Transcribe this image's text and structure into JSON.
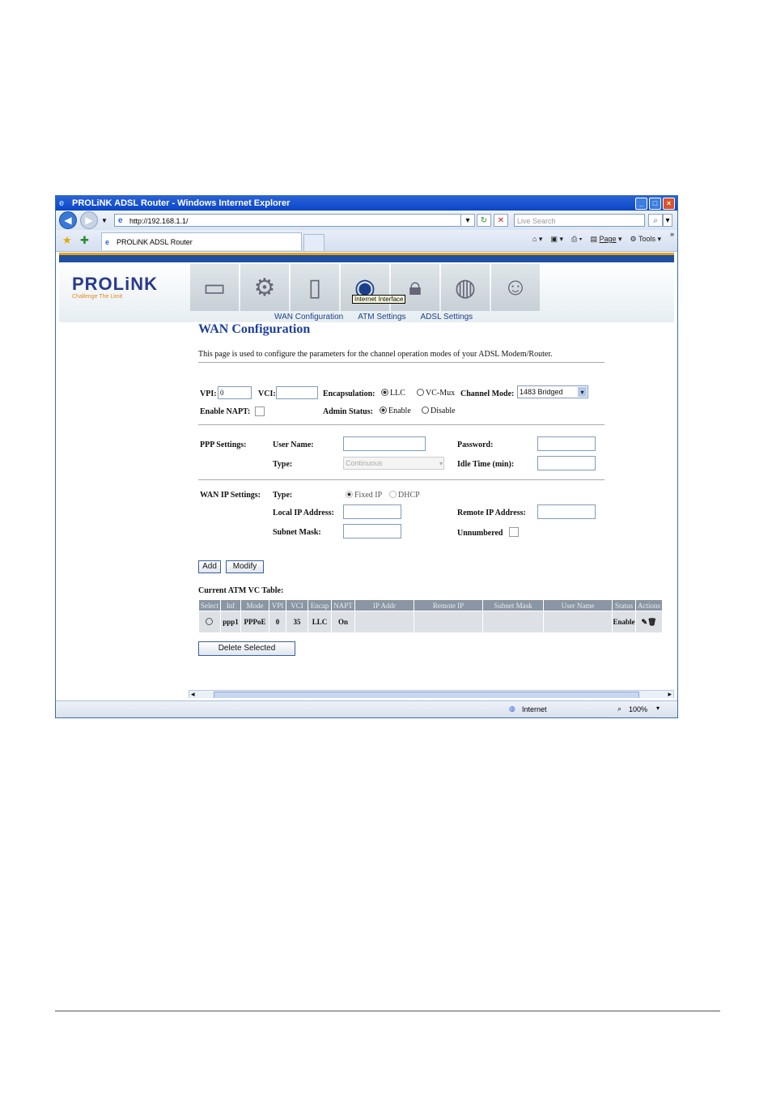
{
  "window": {
    "title": "PROLiNK ADSL Router - Windows Internet Explorer"
  },
  "browser": {
    "url": "http://192.168.1.1/",
    "search_placeholder": "Live Search",
    "tab_title": "PROLiNK ADSL Router",
    "tools": {
      "page": "Page",
      "tools": "Tools"
    }
  },
  "brand": {
    "logo": "PROLiNK",
    "tagline": "Challenge The Limit"
  },
  "tooltip": "Internet Interface",
  "subnav": {
    "wan": "WAN Configuration",
    "atm": "ATM Settings",
    "adsl": "ADSL Settings"
  },
  "page": {
    "title": "WAN Configuration",
    "description": "This page is used to configure the parameters for the channel operation modes of your ADSL Modem/Router."
  },
  "form": {
    "vpi_label": "VPI:",
    "vpi_value": "0",
    "vci_label": "VCI:",
    "vci_value": "",
    "encap_label": "Encapsulation:",
    "llc": "LLC",
    "vcmux": "VC-Mux",
    "channel_mode_label": "Channel Mode:",
    "channel_mode_value": "1483 Bridged",
    "napt_label": "Enable NAPT:",
    "admin_label": "Admin Status:",
    "enable": "Enable",
    "disable": "Disable",
    "ppp_label": "PPP Settings:",
    "user_label": "User Name:",
    "password_label": "Password:",
    "type_label": "Type:",
    "type_value": "Continuous",
    "idle_label": "Idle Time (min):",
    "wanip_label": "WAN IP Settings:",
    "wantype_label": "Type:",
    "fixed_ip": "Fixed IP",
    "dhcp": "DHCP",
    "local_ip_label": "Local IP Address:",
    "remote_ip_label": "Remote IP Address:",
    "subnet_label": "Subnet Mask:",
    "unnumbered_label": "Unnumbered",
    "add": "Add",
    "modify": "Modify"
  },
  "table": {
    "caption": "Current ATM VC Table:",
    "headers": [
      "Select",
      "Inf",
      "Mode",
      "VPI",
      "VCI",
      "Encap",
      "NAPT",
      "IP Addr",
      "Remote IP",
      "Subnet Mask",
      "User Name",
      "Status",
      "Actions"
    ],
    "row": {
      "inf": "ppp1",
      "mode": "PPPoE",
      "vpi": "0",
      "vci": "35",
      "encap": "LLC",
      "napt": "On",
      "ip": "",
      "remote": "",
      "subnet": "",
      "user": "",
      "status": "Enable"
    },
    "delete": "Delete Selected"
  },
  "status": {
    "zone": "Internet",
    "zoom": "100%"
  }
}
